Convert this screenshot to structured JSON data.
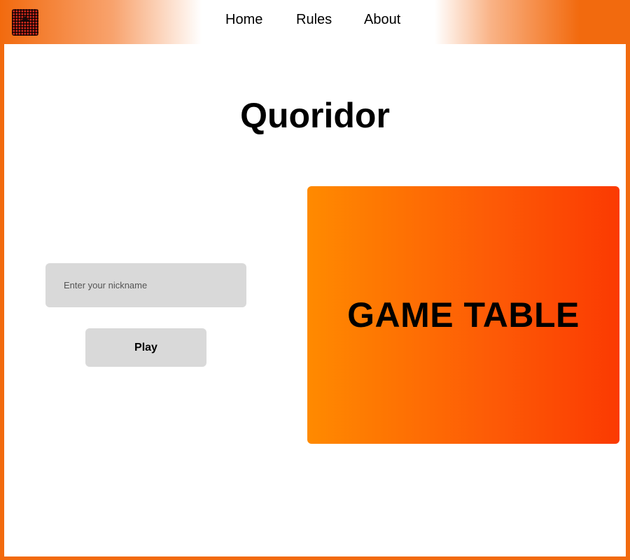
{
  "header": {
    "logo_icon": "grid-board-logo-icon",
    "nav": [
      {
        "label": "Home"
      },
      {
        "label": "Rules"
      },
      {
        "label": "About"
      }
    ]
  },
  "main": {
    "title": "Quoridor",
    "nickname": {
      "placeholder": "Enter your nickname",
      "value": ""
    },
    "play_label": "Play",
    "game_table_label": "GAME TABLE"
  },
  "colors": {
    "accent": "#f26a0e",
    "table_gradient_start": "#ff8a00",
    "table_gradient_end": "#fb3a02",
    "control_bg": "#d9d9d9"
  }
}
